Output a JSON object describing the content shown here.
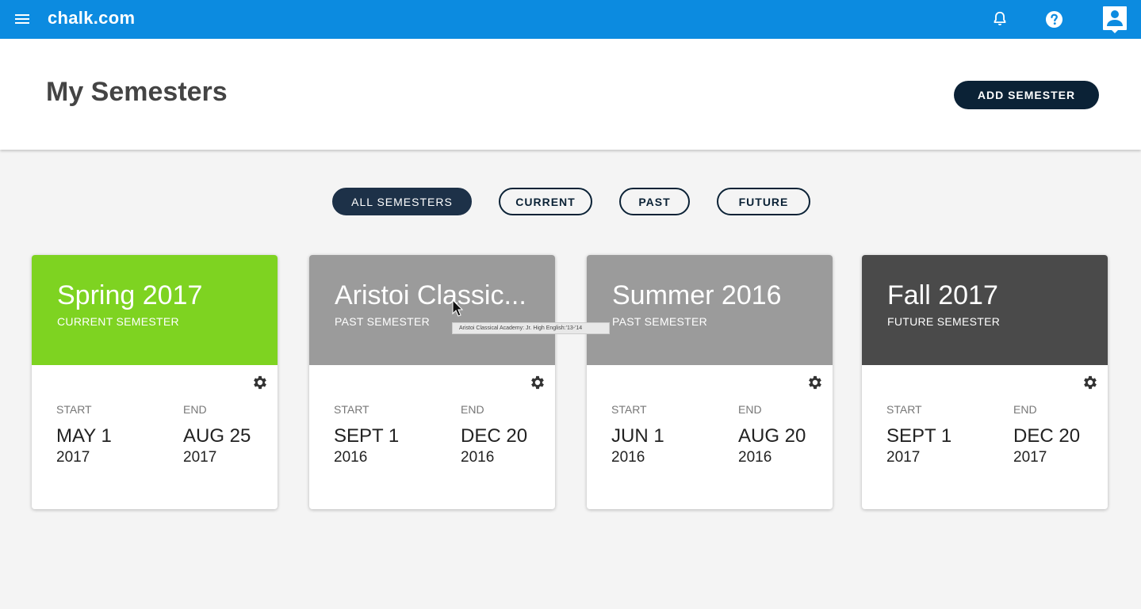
{
  "app": {
    "brand": "chalk.com"
  },
  "header": {
    "title": "My Semesters",
    "add_button": "ADD SEMESTER"
  },
  "filters": [
    {
      "label": "ALL SEMESTERS",
      "active": true
    },
    {
      "label": "CURRENT",
      "active": false
    },
    {
      "label": "PAST",
      "active": false
    },
    {
      "label": "FUTURE",
      "active": false
    }
  ],
  "cards": [
    {
      "title": "Spring 2017",
      "subtitle": "CURRENT SEMESTER",
      "color": "#7ed321",
      "start_label": "START",
      "start_date": "MAY 1",
      "start_year": "2017",
      "end_label": "END",
      "end_date": "AUG 25",
      "end_year": "2017"
    },
    {
      "title": "Aristoi Classic...",
      "subtitle": "PAST SEMESTER",
      "color": "#9b9b9b",
      "start_label": "START",
      "start_date": "SEPT 1",
      "start_year": "2016",
      "end_label": "END",
      "end_date": "DEC 20",
      "end_year": "2016"
    },
    {
      "title": "Summer 2016",
      "subtitle": "PAST SEMESTER",
      "color": "#9b9b9b",
      "start_label": "START",
      "start_date": "JUN 1",
      "start_year": "2016",
      "end_label": "END",
      "end_date": "AUG 20",
      "end_year": "2016"
    },
    {
      "title": "Fall 2017",
      "subtitle": "FUTURE SEMESTER",
      "color": "#4a4a4a",
      "start_label": "START",
      "start_date": "SEPT 1",
      "start_year": "2017",
      "end_label": "END",
      "end_date": "DEC 20",
      "end_year": "2017"
    }
  ],
  "tooltip": "Aristoi Classical Academy:  Jr. High English:'13-'14",
  "icons": {
    "menu": "menu-icon",
    "notifications": "bell-icon",
    "help": "help-icon",
    "profile": "profile-icon",
    "settings": "gear-icon"
  },
  "colors": {
    "topbar": "#0c8be0",
    "navy": "#0b2236"
  }
}
